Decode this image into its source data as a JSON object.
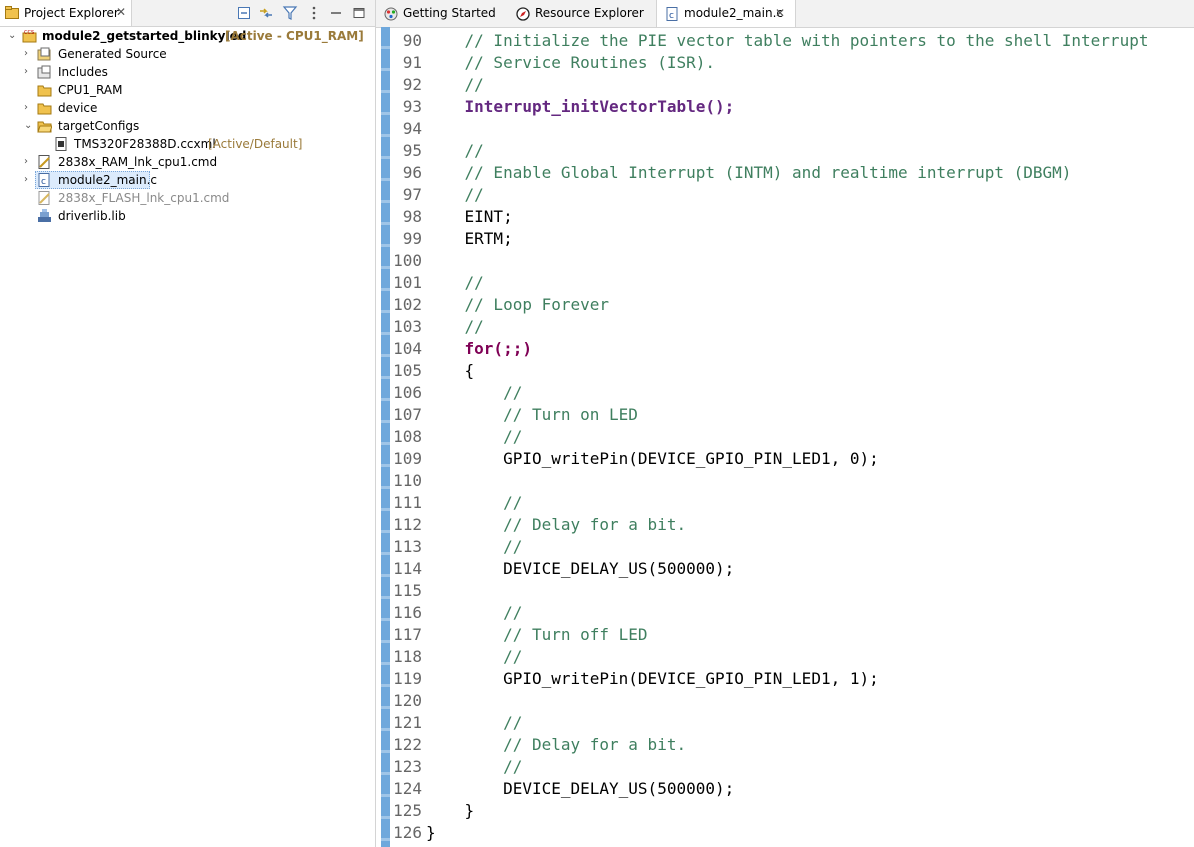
{
  "explorer": {
    "tab_label": "Project Explorer",
    "tree": [
      {
        "label": "module2_getstarted_blinkyled",
        "decoration": "[Active - CPU1_RAM]",
        "icon": "project-icon",
        "expanded": true
      },
      {
        "label": "Generated Source",
        "icon": "source-folder-icon"
      },
      {
        "label": "Includes",
        "icon": "includes-icon"
      },
      {
        "label": "CPU1_RAM",
        "icon": "folder-icon"
      },
      {
        "label": "device",
        "icon": "folder-icon"
      },
      {
        "label": "targetConfigs",
        "icon": "folder-icon",
        "expanded": true
      },
      {
        "label": "TMS320F28388D.ccxml",
        "decoration": "[Active/Default]",
        "icon": "ccxml-file-icon"
      },
      {
        "label": "2838x_RAM_lnk_cpu1.cmd",
        "icon": "cmd-file-icon"
      },
      {
        "label": "module2_main.c",
        "icon": "c-file-icon",
        "selected": true
      },
      {
        "label": "2838x_FLASH_lnk_cpu1.cmd",
        "icon": "cmd-file-excluded-icon",
        "excluded": true
      },
      {
        "label": "driverlib.lib",
        "icon": "library-icon"
      }
    ]
  },
  "editor": {
    "tabs": [
      {
        "label": "Getting Started",
        "icon": "getting-started-icon"
      },
      {
        "label": "Resource Explorer",
        "icon": "resource-explorer-icon"
      },
      {
        "label": "module2_main.c",
        "icon": "c-file-icon",
        "active": true
      }
    ],
    "lines": [
      {
        "n": "90",
        "t": "    // Initialize the PIE vector table with pointers to the shell Interrupt"
      },
      {
        "n": "91",
        "t": "    // Service Routines (ISR)."
      },
      {
        "n": "92",
        "t": "    //"
      },
      {
        "n": "93",
        "t": "    Interrupt_initVectorTable();"
      },
      {
        "n": "94",
        "t": ""
      },
      {
        "n": "95",
        "t": "    //"
      },
      {
        "n": "96",
        "t": "    // Enable Global Interrupt (INTM) and realtime interrupt (DBGM)"
      },
      {
        "n": "97",
        "t": "    //"
      },
      {
        "n": "98",
        "t": "    EINT;"
      },
      {
        "n": "99",
        "t": "    ERTM;"
      },
      {
        "n": "100",
        "t": ""
      },
      {
        "n": "101",
        "t": "    //"
      },
      {
        "n": "102",
        "t": "    // Loop Forever"
      },
      {
        "n": "103",
        "t": "    //"
      },
      {
        "n": "104",
        "t": "    for(;;)"
      },
      {
        "n": "105",
        "t": "    {"
      },
      {
        "n": "106",
        "t": "        //"
      },
      {
        "n": "107",
        "t": "        // Turn on LED"
      },
      {
        "n": "108",
        "t": "        //"
      },
      {
        "n": "109",
        "t": "        GPIO_writePin(DEVICE_GPIO_PIN_LED1, 0);"
      },
      {
        "n": "110",
        "t": ""
      },
      {
        "n": "111",
        "t": "        //"
      },
      {
        "n": "112",
        "t": "        // Delay for a bit."
      },
      {
        "n": "113",
        "t": "        //"
      },
      {
        "n": "114",
        "t": "        DEVICE_DELAY_US(500000);"
      },
      {
        "n": "115",
        "t": ""
      },
      {
        "n": "116",
        "t": "        //"
      },
      {
        "n": "117",
        "t": "        // Turn off LED"
      },
      {
        "n": "118",
        "t": "        //"
      },
      {
        "n": "119",
        "t": "        GPIO_writePin(DEVICE_GPIO_PIN_LED1, 1);"
      },
      {
        "n": "120",
        "t": ""
      },
      {
        "n": "121",
        "t": "        //"
      },
      {
        "n": "122",
        "t": "        // Delay for a bit."
      },
      {
        "n": "123",
        "t": "        //"
      },
      {
        "n": "124",
        "t": "        DEVICE_DELAY_US(500000);"
      },
      {
        "n": "125",
        "t": "    }"
      },
      {
        "n": "126",
        "t": "}"
      }
    ]
  }
}
